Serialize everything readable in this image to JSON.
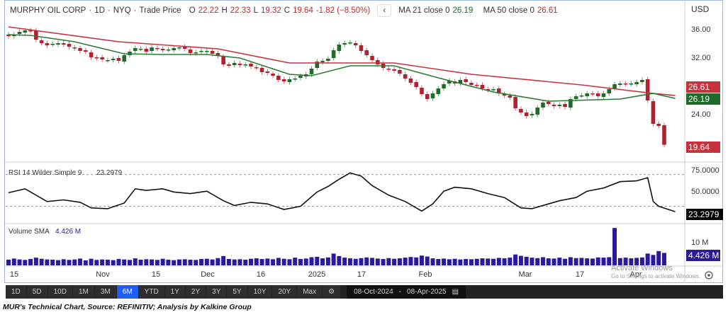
{
  "header": {
    "symbol": "MURPHY OIL CORP",
    "interval": "1D",
    "exchange": "NYQ",
    "price_type": "Trade Price",
    "open_label": "O",
    "open": "22.22",
    "high_label": "H",
    "high": "22.33",
    "low_label": "L",
    "low": "19.32",
    "close_label": "C",
    "close": "19.64",
    "change": "-1.82 (−8.50%)",
    "ma21_label": "MA 21 close 0",
    "ma21_value": "26.19",
    "ma50_label": "MA 50 close 0",
    "ma50_value": "26.61",
    "currency": "USD"
  },
  "price_axis": {
    "ticks": [
      "36.00",
      "32.00",
      "24.00"
    ],
    "tick_values": [
      36,
      32,
      24
    ],
    "tags": {
      "ma50": "26.61",
      "ma21": "26.19",
      "last": "19.64"
    }
  },
  "rsi": {
    "label": "RSI 14 Wilder Simple 9",
    "value": "23.2979",
    "ticks": [
      "75.0000",
      "50.0000"
    ]
  },
  "volume": {
    "label": "Volume SMA",
    "value": "4.426 M",
    "tick": "10 M"
  },
  "time_axis": [
    "15",
    "Nov",
    "15",
    "Dec",
    "16",
    "2025",
    "17",
    "Feb",
    "Mar",
    "17",
    "Apr"
  ],
  "toolbar": {
    "ranges": [
      "1D",
      "5D",
      "10D",
      "1M",
      "3M",
      "6M",
      "YTD",
      "1Y",
      "2Y",
      "3Y",
      "5Y",
      "10Y",
      "20Y",
      "Max"
    ],
    "active": "6M",
    "date_from": "08-Oct-2024",
    "date_sep": "-",
    "date_to": "08-Apr-2025"
  },
  "watermark": {
    "line1": "Activate Windows",
    "line2": "Go to Settings to activate Windows."
  },
  "caption": "MUR's Technical Chart, Source: REFINITIV; Analysis by Kalkine Group",
  "colors": {
    "up": "#1f6b2a",
    "down": "#b5202e",
    "ma50": "#c8323c",
    "ma21": "#2a7a32",
    "volume": "#2a1a9a",
    "accent": "#1e5ef5"
  },
  "chart_data": {
    "type": "candlestick",
    "closes": [
      35.0,
      35.2,
      35.6,
      35.8,
      35.7,
      34.5,
      34.0,
      33.7,
      33.9,
      34.0,
      33.8,
      33.5,
      33.3,
      32.9,
      32.8,
      32.0,
      31.9,
      31.7,
      31.6,
      31.8,
      31.5,
      32.3,
      32.8,
      33.3,
      33.2,
      32.8,
      33.4,
      33.2,
      33.0,
      33.1,
      33.3,
      33.4,
      33.2,
      32.6,
      32.7,
      32.9,
      32.9,
      32.5,
      32.2,
      31.0,
      30.8,
      31.2,
      30.9,
      31.0,
      30.7,
      30.5,
      29.9,
      29.8,
      29.4,
      28.8,
      28.6,
      28.9,
      29.0,
      29.4,
      29.6,
      30.4,
      31.4,
      31.5,
      31.8,
      33.0,
      33.8,
      34.0,
      34.1,
      33.7,
      32.9,
      32.3,
      31.6,
      31.0,
      30.5,
      30.3,
      30.1,
      29.7,
      29.0,
      28.4,
      27.8,
      26.8,
      26.1,
      26.9,
      27.6,
      28.2,
      28.7,
      28.3,
      28.8,
      28.5,
      28.1,
      28.0,
      27.6,
      27.4,
      27.5,
      26.9,
      26.6,
      26.3,
      24.8,
      24.2,
      23.7,
      24.0,
      24.9,
      25.6,
      25.4,
      25.1,
      25.3,
      25.0,
      26.1,
      26.5,
      26.6,
      26.9,
      26.8,
      26.5,
      26.9,
      27.5,
      28.2,
      28.3,
      28.2,
      28.3,
      28.5,
      28.8,
      25.9,
      22.6,
      22.3,
      19.64
    ],
    "ma21": [
      [
        0,
        35.2
      ],
      [
        4,
        35.1
      ],
      [
        12,
        34.2
      ],
      [
        21,
        32.5
      ],
      [
        28,
        32.4
      ],
      [
        36,
        32.4
      ],
      [
        42,
        31.9
      ],
      [
        51,
        29.6
      ],
      [
        55,
        29.4
      ],
      [
        62,
        30.8
      ],
      [
        70,
        30.8
      ],
      [
        78,
        29.1
      ],
      [
        88,
        27.1
      ],
      [
        98,
        25.8
      ],
      [
        111,
        26.1
      ],
      [
        117,
        26.9
      ],
      [
        121,
        26.19
      ]
    ],
    "ma50": [
      [
        0,
        36.3
      ],
      [
        20,
        34.2
      ],
      [
        38,
        33.2
      ],
      [
        51,
        31.2
      ],
      [
        61,
        31.2
      ],
      [
        70,
        31.2
      ],
      [
        84,
        29.6
      ],
      [
        104,
        28.1
      ],
      [
        117,
        26.9
      ],
      [
        121,
        26.61
      ]
    ],
    "rsi": [
      [
        0,
        47
      ],
      [
        3,
        52
      ],
      [
        5,
        44
      ],
      [
        7,
        36
      ],
      [
        10,
        38
      ],
      [
        13,
        35
      ],
      [
        15,
        28
      ],
      [
        18,
        27
      ],
      [
        21,
        34
      ],
      [
        23,
        52
      ],
      [
        25,
        50
      ],
      [
        28,
        52
      ],
      [
        30,
        48
      ],
      [
        33,
        46
      ],
      [
        36,
        49
      ],
      [
        39,
        37
      ],
      [
        41,
        31
      ],
      [
        44,
        35
      ],
      [
        47,
        33
      ],
      [
        50,
        26
      ],
      [
        53,
        30
      ],
      [
        56,
        48
      ],
      [
        58,
        55
      ],
      [
        60,
        64
      ],
      [
        62,
        72
      ],
      [
        64,
        68
      ],
      [
        66,
        56
      ],
      [
        69,
        44
      ],
      [
        72,
        36
      ],
      [
        75,
        24
      ],
      [
        77,
        33
      ],
      [
        79,
        49
      ],
      [
        81,
        54
      ],
      [
        84,
        52
      ],
      [
        87,
        46
      ],
      [
        90,
        41
      ],
      [
        93,
        28
      ],
      [
        95,
        27
      ],
      [
        98,
        33
      ],
      [
        100,
        37
      ],
      [
        103,
        41
      ],
      [
        105,
        49
      ],
      [
        108,
        53
      ],
      [
        111,
        61
      ],
      [
        114,
        62
      ],
      [
        116,
        66
      ],
      [
        117,
        36
      ],
      [
        118,
        30
      ],
      [
        121,
        23.2979
      ]
    ],
    "rsi_levels": [
      70,
      30
    ],
    "volume_m": [
      2.5,
      3,
      2.6,
      2.4,
      2.8,
      3.4,
      2.9,
      2.6,
      2.5,
      2.3,
      2.7,
      2.4,
      2.6,
      3,
      2.2,
      2.9,
      2.4,
      2.6,
      2.5,
      2.3,
      2.8,
      2.6,
      2.4,
      3.1,
      2.5,
      2.7,
      2.6,
      2.4,
      2.9,
      2.5,
      2.3,
      2.6,
      2.7,
      2.5,
      2.4,
      2.8,
      2.9,
      2.6,
      3.2,
      4.1,
      2.8,
      2.6,
      2.7,
      2.5,
      2.9,
      3.1,
      2.8,
      3,
      2.7,
      3.3,
      2.9,
      2.7,
      3.4,
      2.8,
      3,
      3.6,
      3.8,
      3.1,
      3.5,
      5.2,
      4.1,
      3.4,
      3.1,
      2.9,
      3.2,
      3.5,
      3.3,
      3,
      2.8,
      3.2,
      2.9,
      3.1,
      3.4,
      3.7,
      3.5,
      4.3,
      3.9,
      3.1,
      2.8,
      3,
      2.7,
      2.9,
      2.6,
      2.8,
      2.7,
      2.9,
      3.1,
      3,
      2.9,
      3.3,
      3.1,
      3.4,
      4.8,
      4.2,
      3.8,
      3.4,
      3.2,
      3.6,
      3.1,
      3,
      3.4,
      2.9,
      3.6,
      3.2,
      3.3,
      3.1,
      3,
      3.5,
      3.4,
      3.6,
      16.5,
      3.2,
      3.4,
      3.1,
      3.3,
      3.5,
      5.2,
      4.6,
      6.3,
      5.5
    ],
    "price_range": [
      17.5,
      37.3
    ],
    "rsi_range": [
      10,
      83
    ]
  }
}
